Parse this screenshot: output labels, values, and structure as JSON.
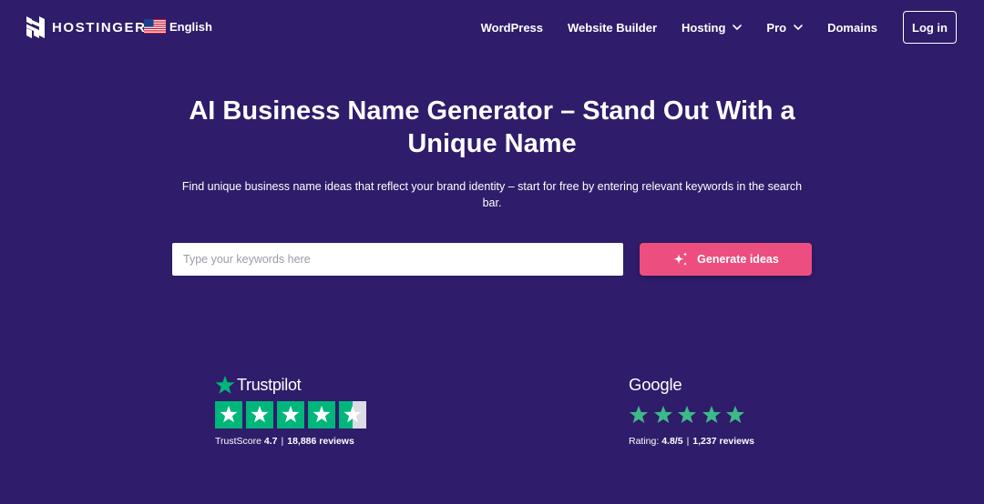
{
  "header": {
    "brand": "HOSTINGER",
    "language": "English",
    "nav": [
      {
        "label": "WordPress"
      },
      {
        "label": "Website Builder"
      },
      {
        "label": "Hosting"
      },
      {
        "label": "Pro"
      },
      {
        "label": "Domains"
      }
    ],
    "login_label": "Log in"
  },
  "hero": {
    "title_line1": "AI Business Name Generator – Stand Out With a",
    "title_line2": "Unique Name",
    "subtitle_line1": "Find unique business name ideas that reflect your brand identity – start for free by entering relevant keywords in the search",
    "subtitle_line2": "bar.",
    "search_placeholder": "Type your keywords here",
    "generate_label": "Generate ideas"
  },
  "trustpilot": {
    "name": "Trustpilot",
    "score_label": "TrustScore",
    "score": "4.7",
    "separator": "|",
    "reviews": "18,886 reviews",
    "stars": 4.5
  },
  "google": {
    "name": "Google",
    "rating_label": "Rating:",
    "rating": "4.8/5",
    "separator": "|",
    "reviews": "1,237 reviews",
    "stars": 5
  },
  "colors": {
    "background": "#2f1c6a",
    "accent": "#ec4e7f",
    "trustpilot_green": "#00b67a",
    "google_star": "#3dba87"
  }
}
